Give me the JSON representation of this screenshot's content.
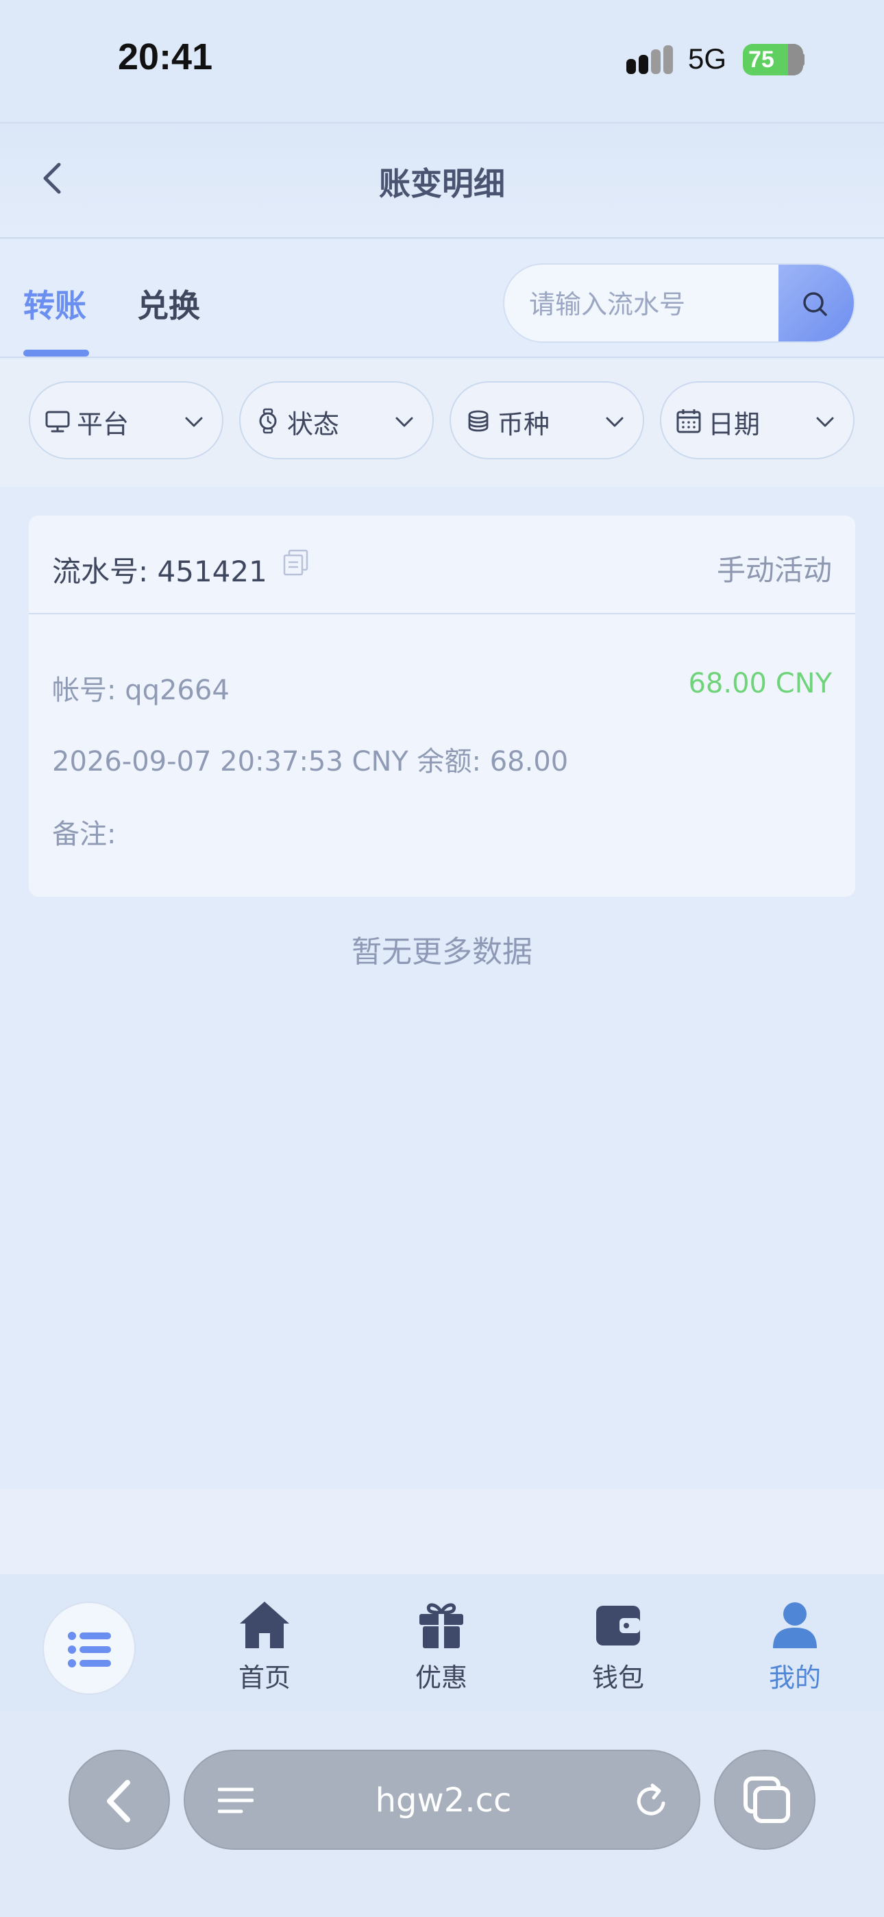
{
  "status_bar": {
    "time": "20:41",
    "network": "5G",
    "battery": "75"
  },
  "header": {
    "title": "账变明细"
  },
  "tabs": [
    {
      "label": "转账",
      "active": true
    },
    {
      "label": "兑换",
      "active": false
    }
  ],
  "search": {
    "placeholder": "请输入流水号"
  },
  "filters": [
    {
      "label": "平台",
      "icon": "monitor-icon"
    },
    {
      "label": "状态",
      "icon": "watch-icon"
    },
    {
      "label": "币种",
      "icon": "coins-icon"
    },
    {
      "label": "日期",
      "icon": "calendar-icon"
    }
  ],
  "record": {
    "serial": "流水号: 451421",
    "type": "手动活动",
    "account": "帐号: qq2664",
    "amount": "68.00 CNY",
    "datetime_balance": "2026-09-07 20:37:53 CNY 余额: 68.00",
    "remark": "备注:"
  },
  "no_more": "暂无更多数据",
  "bottom_nav": [
    {
      "label": "首页",
      "icon": "home-icon"
    },
    {
      "label": "优惠",
      "icon": "gift-icon"
    },
    {
      "label": "钱包",
      "icon": "wallet-icon"
    },
    {
      "label": "我的",
      "icon": "user-icon",
      "active": true
    }
  ],
  "browser": {
    "url": "hgw2.cc"
  },
  "colors": {
    "accent": "#6a8ff0",
    "amount_positive": "#6fd37a",
    "active_nav": "#4f87d6"
  }
}
